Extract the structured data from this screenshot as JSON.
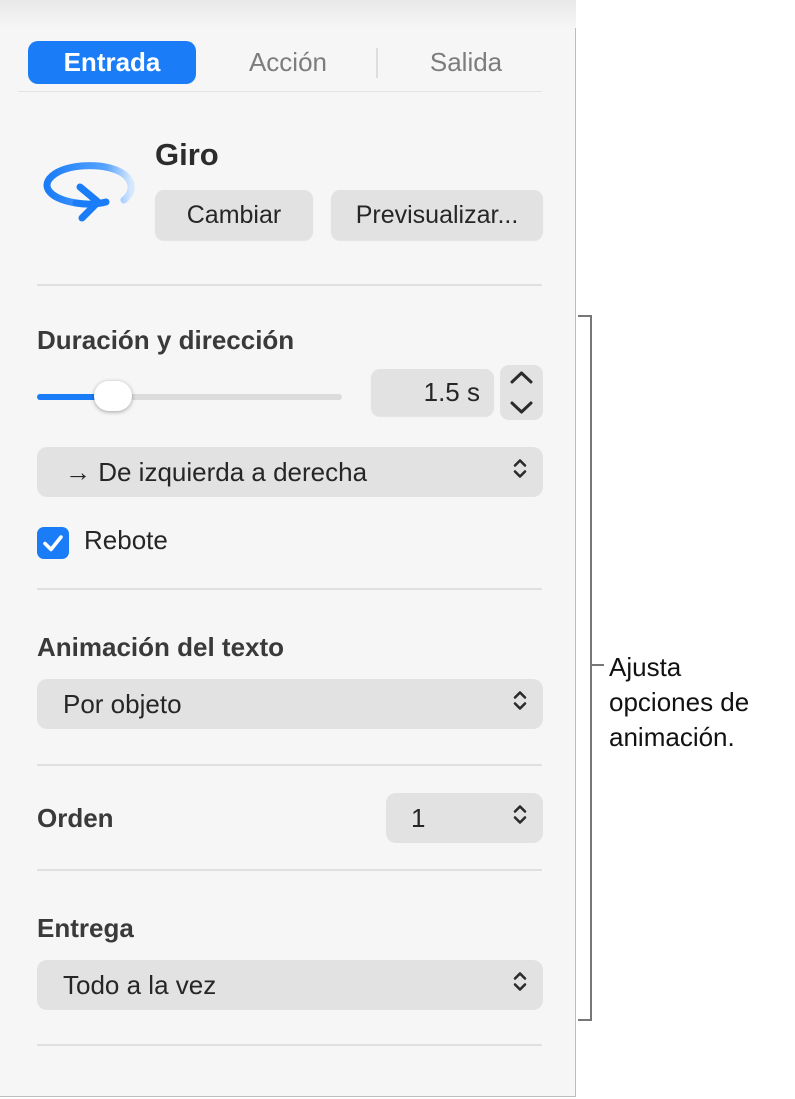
{
  "tabs": [
    {
      "label": "Entrada",
      "active": true
    },
    {
      "label": "Acción",
      "active": false
    },
    {
      "label": "Salida",
      "active": false
    }
  ],
  "effect": {
    "name": "Giro",
    "icon": "spin-arrow-icon",
    "change_label": "Cambiar",
    "preview_label": "Previsualizar..."
  },
  "duration": {
    "label": "Duración y dirección",
    "value_text": "1.5 s",
    "slider_fraction": 0.25,
    "direction_value": "→ De izquierda a derecha",
    "bounce_label": "Rebote",
    "bounce_checked": true
  },
  "text_animation": {
    "label": "Animación del texto",
    "value": "Por objeto"
  },
  "order": {
    "label": "Orden",
    "value": "1"
  },
  "delivery": {
    "label": "Entrega",
    "value": "Todo a la vez"
  },
  "callout": {
    "line1": "Ajusta",
    "line2": "opciones de",
    "line3": "animación."
  },
  "colors": {
    "accent": "#1a7cf7",
    "panel_bg": "#f6f6f6",
    "control_bg": "#e2e2e2"
  }
}
